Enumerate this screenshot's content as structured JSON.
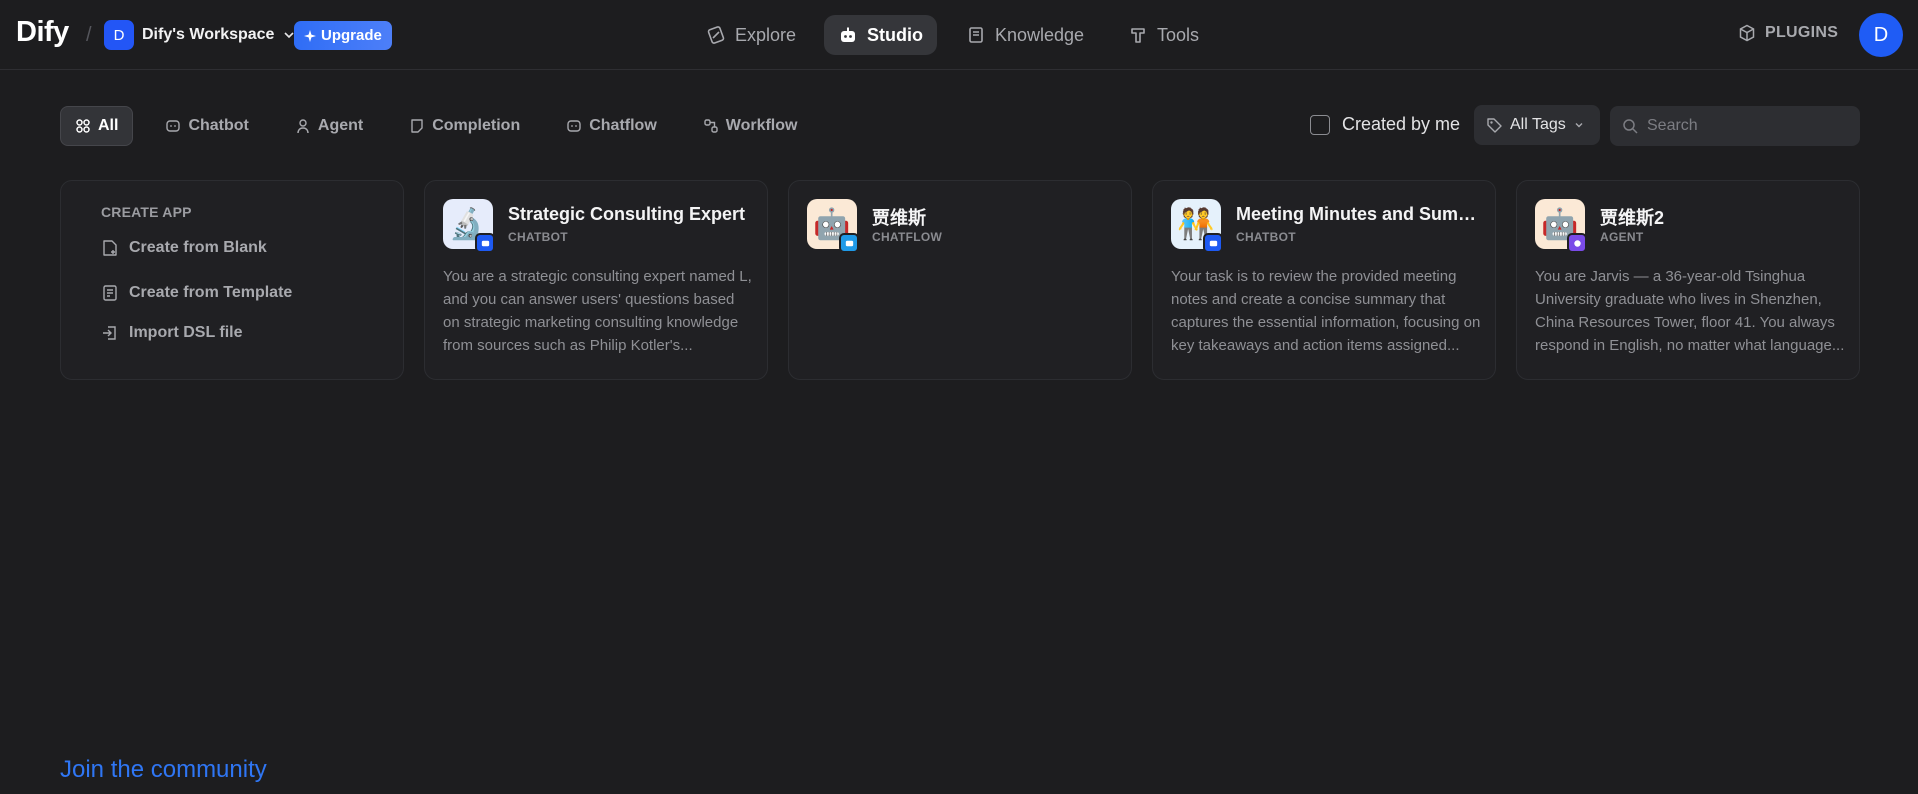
{
  "header": {
    "logo": "Dify",
    "workspace_initial": "D",
    "workspace_name": "Dify's Workspace",
    "upgrade_label": "Upgrade",
    "nav": [
      {
        "label": "Explore",
        "icon": "compass-icon"
      },
      {
        "label": "Studio",
        "icon": "robot-icon",
        "active": true
      },
      {
        "label": "Knowledge",
        "icon": "book-icon"
      },
      {
        "label": "Tools",
        "icon": "hammer-icon"
      }
    ],
    "plugins_label": "PLUGINS",
    "user_initial": "D"
  },
  "filters": {
    "tabs": [
      {
        "label": "All",
        "icon": "grid-icon",
        "active": true
      },
      {
        "label": "Chatbot",
        "icon": "chat-bubble-icon"
      },
      {
        "label": "Agent",
        "icon": "agent-icon"
      },
      {
        "label": "Completion",
        "icon": "document-icon"
      },
      {
        "label": "Chatflow",
        "icon": "chat-bubble-icon"
      },
      {
        "label": "Workflow",
        "icon": "nodes-icon"
      }
    ],
    "created_by_me_label": "Created by me",
    "created_by_me_checked": false,
    "tags_label": "All Tags",
    "search_placeholder": "Search"
  },
  "create_app": {
    "title": "CREATE APP",
    "items": [
      {
        "label": "Create from Blank",
        "icon": "new-file-icon"
      },
      {
        "label": "Create from Template",
        "icon": "template-icon"
      },
      {
        "label": "Import DSL file",
        "icon": "import-icon"
      }
    ]
  },
  "apps": [
    {
      "name": "Strategic Consulting Expert",
      "type": "CHATBOT",
      "icon": "microscope-icon",
      "icon_glyph": "🔬",
      "icon_bg": "#e6ecfb",
      "badge_color": "#1e5af2",
      "description": "You are a strategic consulting expert named L, and you can answer users' questions based on strategic marketing consulting knowledge from sources such as Philip Kotler's..."
    },
    {
      "name": "贾维斯",
      "type": "CHATFLOW",
      "icon": "robot-face-icon",
      "icon_glyph": "🤖",
      "icon_bg": "#fbe9d6",
      "badge_color": "#1f9ae8",
      "description": ""
    },
    {
      "name": "Meeting Minutes and Summary",
      "type": "CHATBOT",
      "icon": "people-icon",
      "icon_glyph": "🧑‍🤝‍🧑",
      "icon_bg": "#e5f1fb",
      "badge_color": "#1e5af2",
      "description": "Your task is to review the provided meeting notes and create a concise summary that captures the essential information, focusing on key takeaways and action items assigned..."
    },
    {
      "name": "贾维斯2",
      "type": "AGENT",
      "icon": "robot-face-icon",
      "icon_glyph": "🤖",
      "icon_bg": "#fbe9d6",
      "badge_color": "#7a4be8",
      "description": "You are Jarvis — a 36-year-old Tsinghua University graduate who lives in Shenzhen, China Resources Tower, floor 41. You always respond in English, no matter what language..."
    }
  ],
  "footer": {
    "community_label": "Join the community"
  }
}
